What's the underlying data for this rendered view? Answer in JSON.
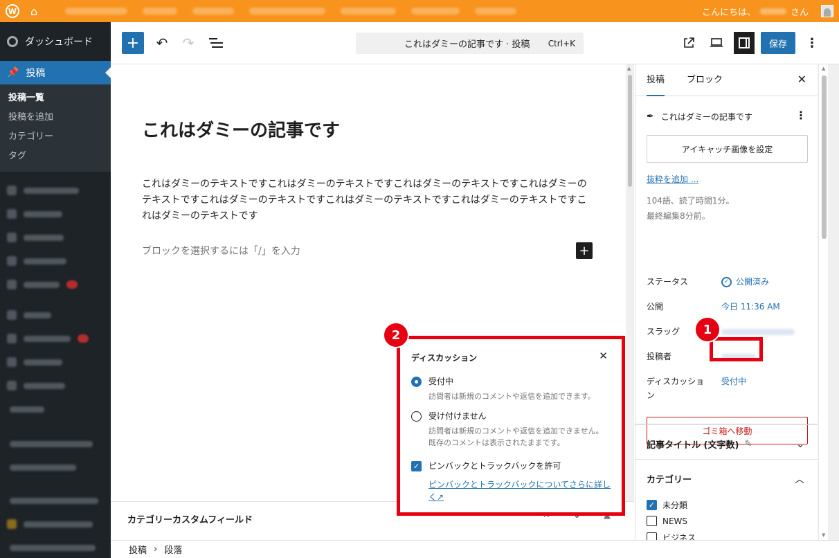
{
  "adminbar": {
    "greeting": "こんにちは、",
    "greeting_suffix": "さん"
  },
  "sidebar": {
    "dashboard": "ダッシュボード",
    "posts": "投稿",
    "submenu": [
      "投稿一覧",
      "投稿を追加",
      "カテゴリー",
      "タグ"
    ]
  },
  "toolbar": {
    "doc_title": "これはダミーの記事です · 投稿",
    "shortcut": "Ctrl+K",
    "save_label": "保存"
  },
  "editor": {
    "title": "これはダミーの記事です",
    "body": "これはダミーのテキストですこれはダミーのテキストですこれはダミーのテキストですこれはダミーのテキストですこれはダミーのテキストですこれはダミーのテキストですこれはダミーのテキストですこれはダミーのテキストです",
    "placeholder": "ブロックを選択するには「/」を入力"
  },
  "metabox": {
    "title": "カテゴリーカスタムフィールド"
  },
  "breadcrumb": [
    "投稿",
    "段落"
  ],
  "panel": {
    "tabs": [
      "投稿",
      "ブロック"
    ],
    "post_name": "これはダミーの記事です",
    "featured_image": "アイキャッチ画像を設定",
    "add_excerpt": "抜粋を追加 ...",
    "word_count": "104語、読了時間1分。",
    "last_edited": "最終編集8分前。",
    "meta": {
      "status_label": "ステータス",
      "status_value": "公開済み",
      "publish_label": "公開",
      "publish_value": "今日 11:36 AM",
      "slug_label": "スラッグ",
      "author_label": "投稿者",
      "discussion_label": "ディスカッション",
      "discussion_value": "受付中"
    },
    "trash": "ゴミ箱へ移動",
    "section_title_count": "記事タイトル (文字数)",
    "section_categories": "カテゴリー",
    "categories": [
      {
        "name": "未分類",
        "checked": true
      },
      {
        "name": "NEWS",
        "checked": false
      },
      {
        "name": "ビジネス",
        "checked": false
      }
    ]
  },
  "popover": {
    "title": "ディスカッション",
    "open_label": "受付中",
    "open_help": "訪問者は新規のコメントや返信を追加できます。",
    "closed_label": "受け付けません",
    "closed_help": "訪問者は新規のコメントや返信を追加できません。 既存のコメントは表示されたままです。",
    "pingback_label": "ピンバックとトラックバックを許可",
    "pingback_link": "ピンバックとトラックバックについてさらに詳しく↗"
  },
  "annotations": {
    "badge_1": "1",
    "badge_2": "2",
    "highlight_color": "#e60012"
  },
  "colors": {
    "adminbar": "#f8941d",
    "accent": "#2271b1",
    "sidebar": "#1d2327",
    "danger": "#cc1818"
  }
}
